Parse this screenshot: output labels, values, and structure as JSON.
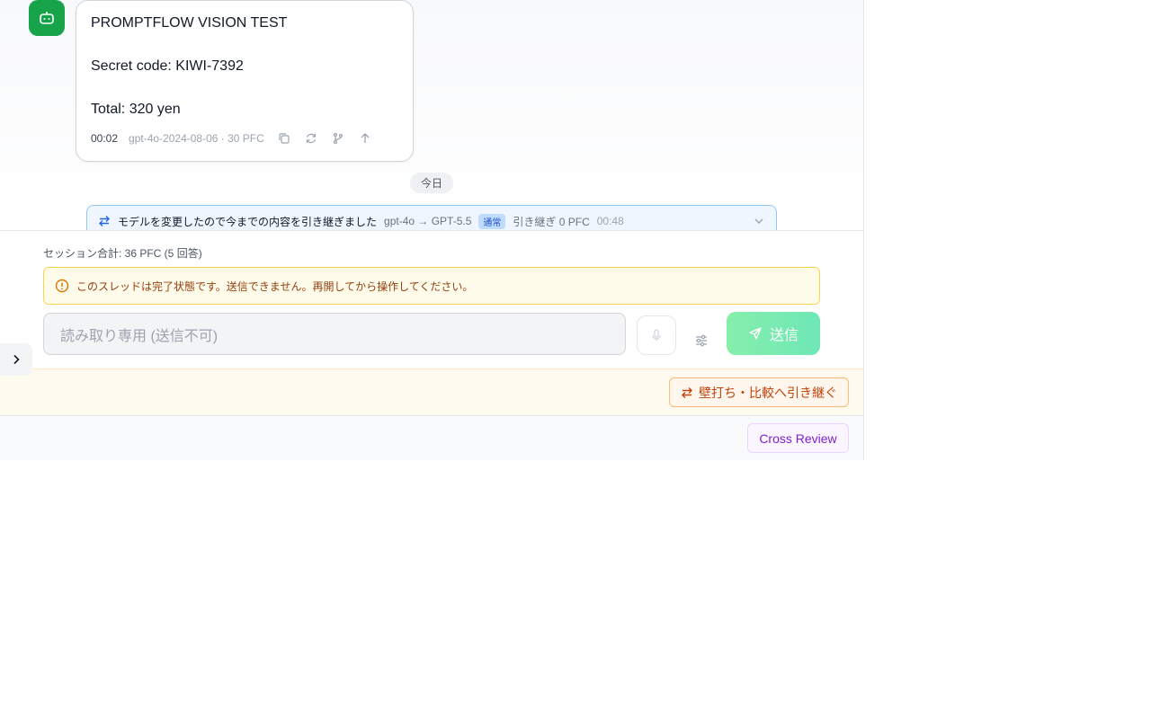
{
  "message": {
    "lines": [
      "PROMPTFLOW VISION TEST",
      "Secret code: KIWI-7392",
      "Total: 320 yen"
    ],
    "time": "00:02",
    "model_info": "gpt-4o-2024-08-06 · 30 PFC",
    "actions": [
      "copy-icon",
      "regenerate-icon",
      "branch-icon",
      "scroll-up-icon"
    ]
  },
  "divider": {
    "label": "今日"
  },
  "handoff": {
    "text": "モデルを変更したので今までの内容を引き継ぎました",
    "models": "gpt-4o → GPT-5.5",
    "badge": "通常",
    "carry": "引き継ぎ 0 PFC",
    "time": "00:48"
  },
  "composer": {
    "session_total": "セッション合計: 36 PFC (5 回答)",
    "warning": "このスレッドは完了状態です。送信できません。再開してから操作してください。",
    "input_placeholder": "読み取り専用 (送信不可)",
    "send_label": "送信"
  },
  "wall": {
    "label": "壁打ち・比較へ引き継ぐ"
  },
  "cross_review": {
    "label": "Cross Review"
  },
  "colors": {
    "accent_green": "#16a34a",
    "warning_bg": "#fffbeb",
    "wall_orange": "#c2410c",
    "cross_purple": "#7e22ce"
  }
}
